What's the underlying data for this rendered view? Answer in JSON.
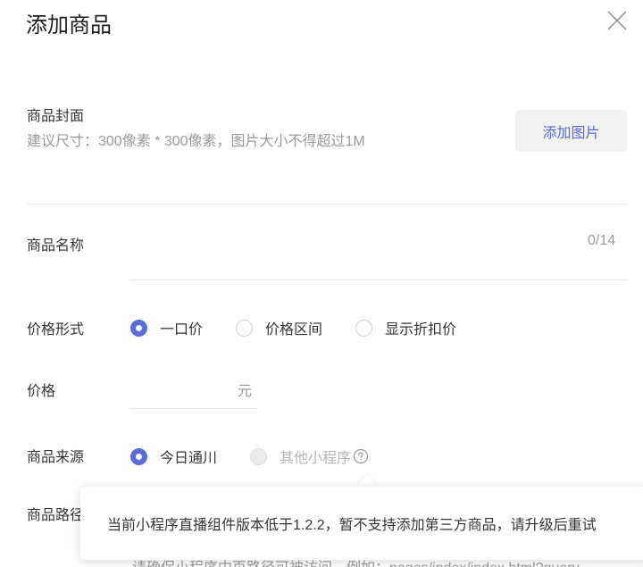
{
  "dialog": {
    "title": "添加商品",
    "close_icon": "close-icon"
  },
  "cover": {
    "label": "商品封面",
    "hint": "建议尺寸：300像素 * 300像素，图片大小不得超过1M",
    "button_label": "添加图片"
  },
  "name": {
    "label": "商品名称",
    "value": "",
    "count": "0/14"
  },
  "price_type": {
    "label": "价格形式",
    "options": [
      {
        "label": "一口价",
        "checked": true
      },
      {
        "label": "价格区间",
        "checked": false
      },
      {
        "label": "显示折扣价",
        "checked": false
      }
    ]
  },
  "price": {
    "label": "价格",
    "value": "",
    "unit": "元"
  },
  "source": {
    "label": "商品来源",
    "options": [
      {
        "label": "今日通川",
        "checked": true,
        "disabled": false
      },
      {
        "label": "其他小程序",
        "checked": false,
        "disabled": true
      }
    ],
    "help_icon": "question-circle-icon"
  },
  "path": {
    "label": "商品路径",
    "hint": "请确保小程序中页路径可被访问，例如：pages/index/index.html?query"
  },
  "tooltip": {
    "text": "当前小程序直播组件版本低于1.2.2，暂不支持添加第三方商品，请升级后重试"
  },
  "colors": {
    "accent": "#5c6bd6",
    "text": "#353535",
    "muted": "#9a9a9a",
    "divider": "#e8e8e8"
  }
}
